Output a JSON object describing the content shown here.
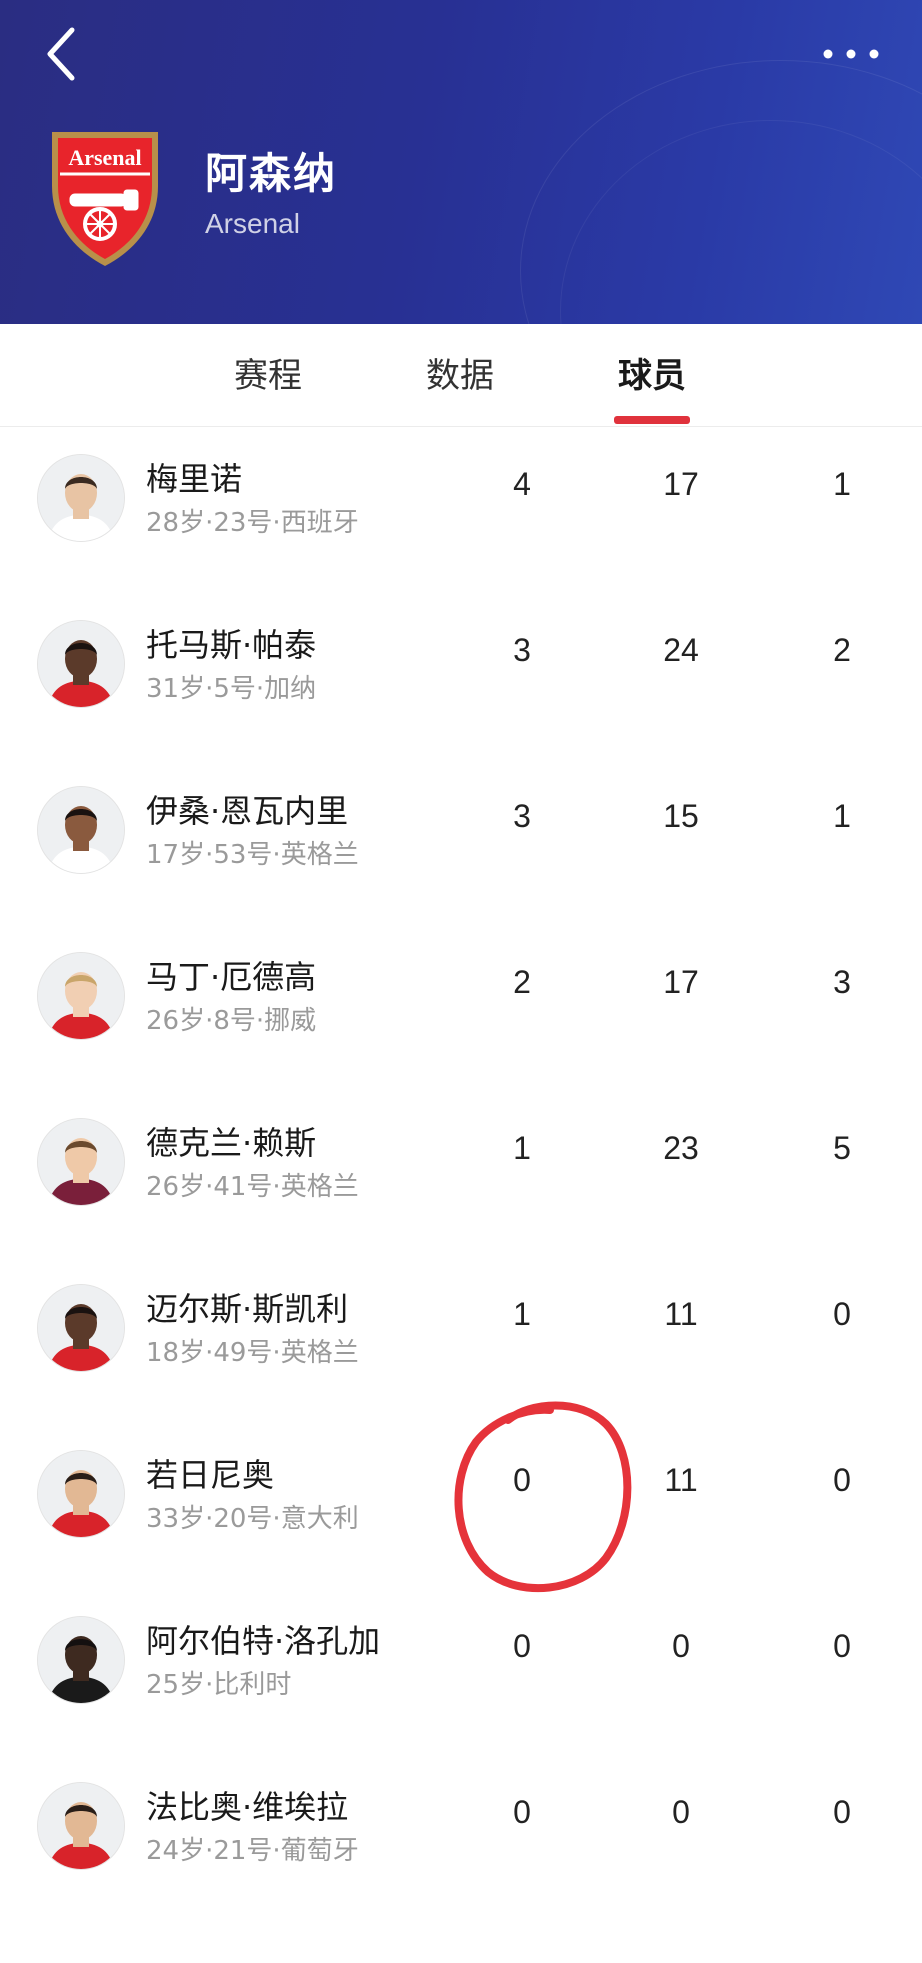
{
  "header": {
    "team_name_cn": "阿森纳",
    "team_name_en": "Arsenal",
    "crest_text": "Arsenal"
  },
  "tabs": [
    {
      "label": "赛程",
      "active": false
    },
    {
      "label": "数据",
      "active": false
    },
    {
      "label": "球员",
      "active": true
    }
  ],
  "players": [
    {
      "name": "梅里诺",
      "meta": "28岁·23号·西班牙",
      "stats": [
        "4",
        "17",
        "1"
      ],
      "skin": "#e8c4a4",
      "hair": "#3a2a20",
      "kit": "#ffffff"
    },
    {
      "name": "托马斯·帕泰",
      "meta": "31岁·5号·加纳",
      "stats": [
        "3",
        "24",
        "2"
      ],
      "skin": "#5b3a2a",
      "hair": "#1a1210",
      "kit": "#d8232a"
    },
    {
      "name": "伊桑·恩瓦内里",
      "meta": "17岁·53号·英格兰",
      "stats": [
        "3",
        "15",
        "1"
      ],
      "skin": "#8a5a3e",
      "hair": "#1a1210",
      "kit": "#ffffff"
    },
    {
      "name": "马丁·厄德高",
      "meta": "26岁·8号·挪威",
      "stats": [
        "2",
        "17",
        "3"
      ],
      "skin": "#f1cfb3",
      "hair": "#c9a56a",
      "kit": "#d8232a"
    },
    {
      "name": "德克兰·赖斯",
      "meta": "26岁·41号·英格兰",
      "stats": [
        "1",
        "23",
        "5"
      ],
      "skin": "#efc9a8",
      "hair": "#6b4a2e",
      "kit": "#7a1f3a"
    },
    {
      "name": "迈尔斯·斯凯利",
      "meta": "18岁·49号·英格兰",
      "stats": [
        "1",
        "11",
        "0"
      ],
      "skin": "#5b3a2a",
      "hair": "#1a1210",
      "kit": "#d8232a"
    },
    {
      "name": "若日尼奥",
      "meta": "33岁·20号·意大利",
      "stats": [
        "0",
        "11",
        "0"
      ],
      "skin": "#e2b894",
      "hair": "#2a1e18",
      "kit": "#d8232a"
    },
    {
      "name": "阿尔伯特·洛孔加",
      "meta": "25岁·比利时",
      "stats": [
        "0",
        "0",
        "0"
      ],
      "skin": "#3e2a20",
      "hair": "#141010",
      "kit": "#1a1a1a"
    },
    {
      "name": "法比奥·维埃拉",
      "meta": "24岁·21号·葡萄牙",
      "stats": [
        "0",
        "0",
        "0"
      ],
      "skin": "#e2b894",
      "hair": "#2a1e18",
      "kit": "#d8232a"
    }
  ],
  "colors": {
    "header_bg": "#2a3199",
    "tab_indicator": "#e0323c",
    "annotation": "#e5333a"
  }
}
